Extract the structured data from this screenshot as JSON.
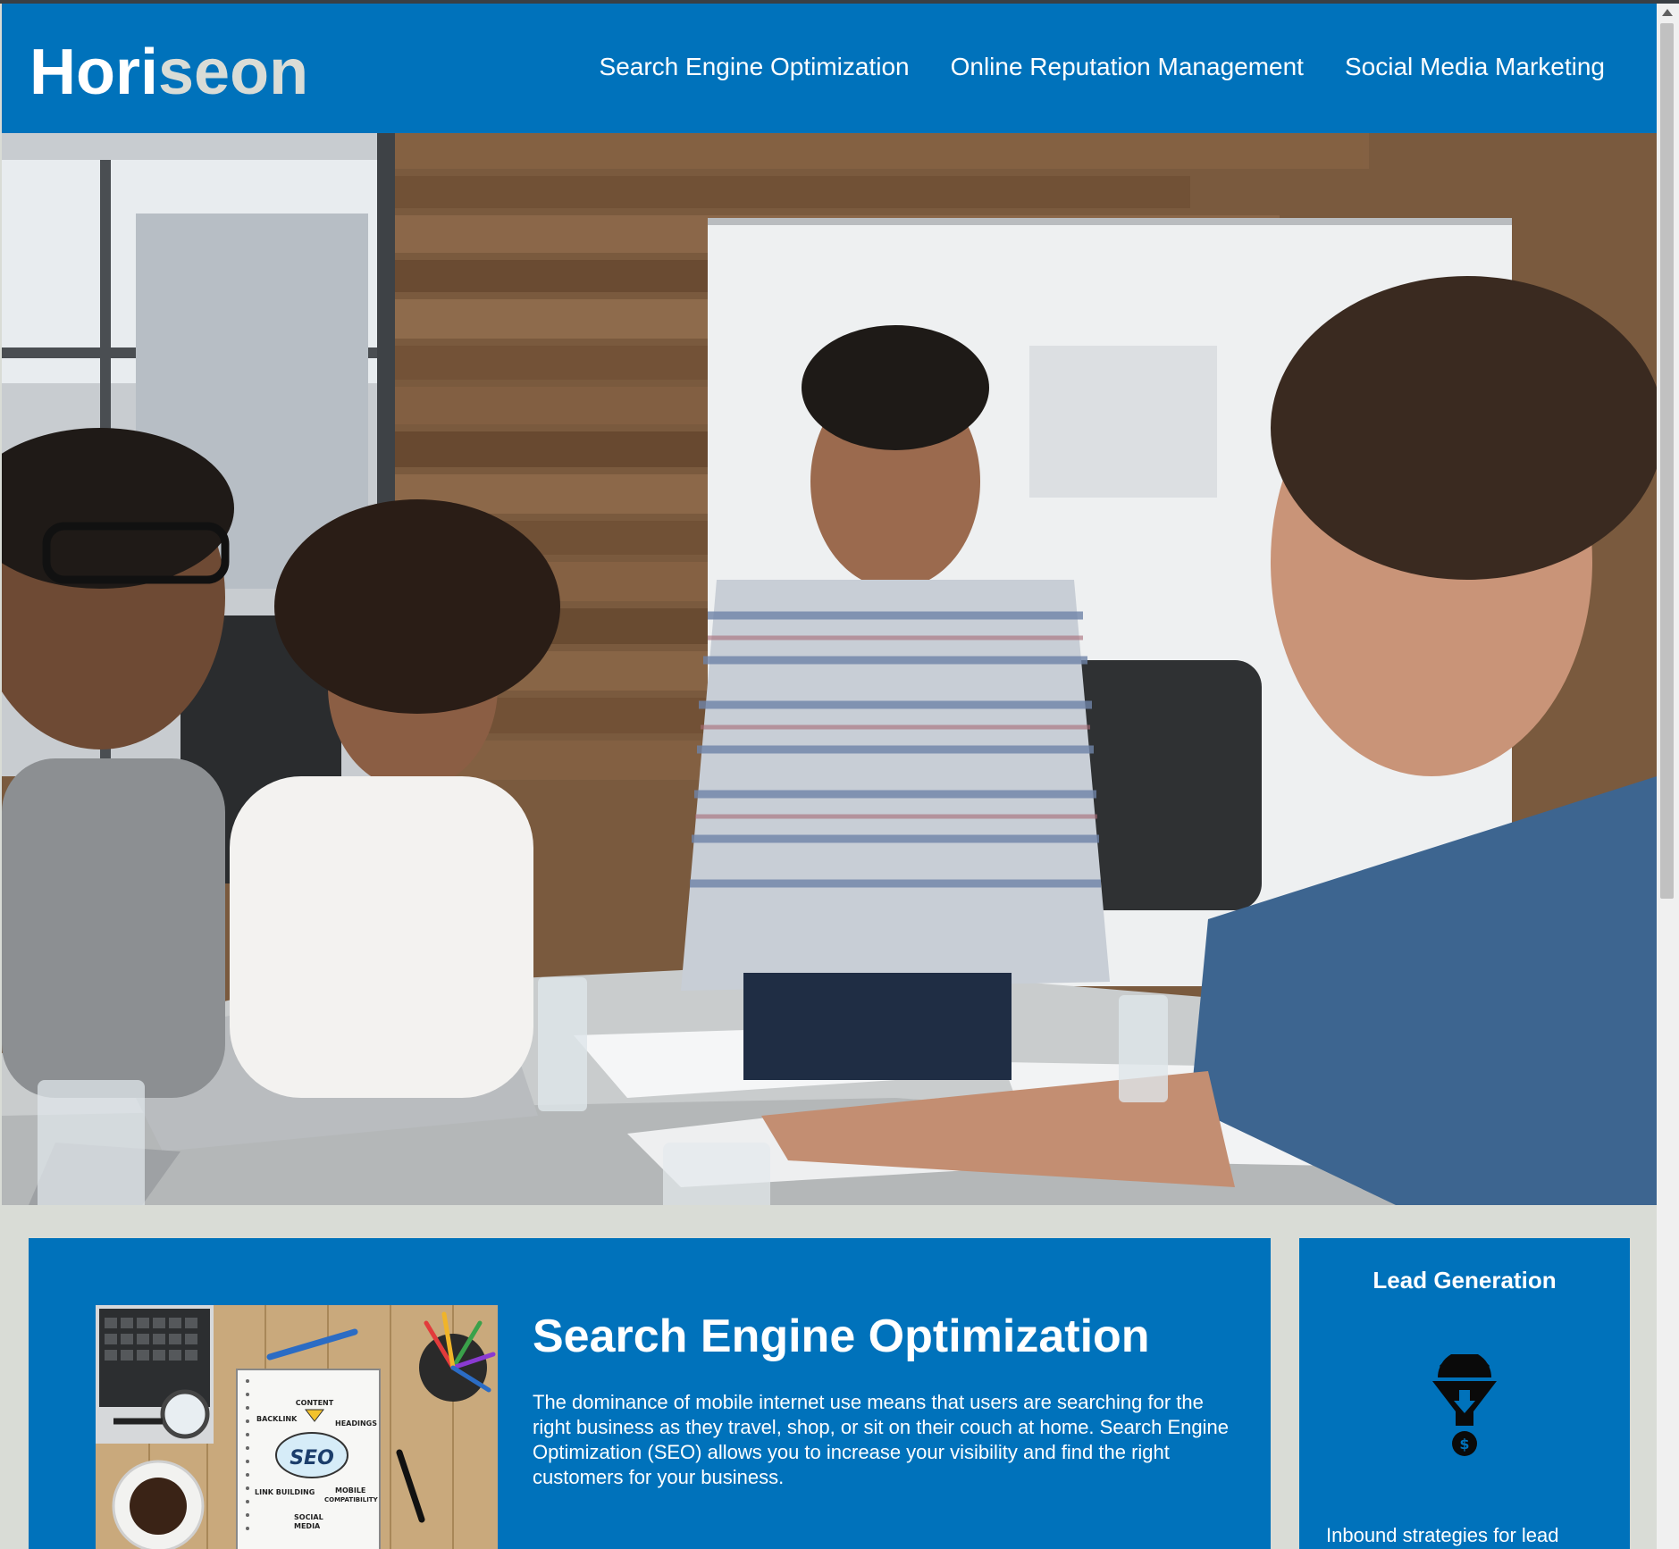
{
  "header": {
    "logo_main": "Hori",
    "logo_accent": "seon",
    "nav": [
      {
        "label": "Search Engine Optimization"
      },
      {
        "label": "Online Reputation Management"
      },
      {
        "label": "Social Media Marketing"
      }
    ]
  },
  "content": {
    "title": "Search Engine Optimization",
    "text": "The dominance of mobile internet use means that users are searching for the right business as they travel, shop, or sit on their couch at home. Search Engine Optimization (SEO) allows you to increase your visibility and find the right customers for your business.",
    "image_words": {
      "content": "CONTENT",
      "backlink": "BACKLINK",
      "headings": "HEADINGS",
      "seo": "SEO",
      "link_building": "LINK BUILDING",
      "mobile": "MOBILE",
      "compatibility": "COMPATIBILITY",
      "social": "SOCIAL",
      "media": "MEDIA"
    }
  },
  "benefit": {
    "title": "Lead Generation",
    "icon": "lead-generation-funnel-icon",
    "text": "Inbound strategies for lead"
  },
  "colors": {
    "brand_blue": "#0072bb",
    "background": "#d9dcd6",
    "logo_accent": "#d9dcd6"
  }
}
